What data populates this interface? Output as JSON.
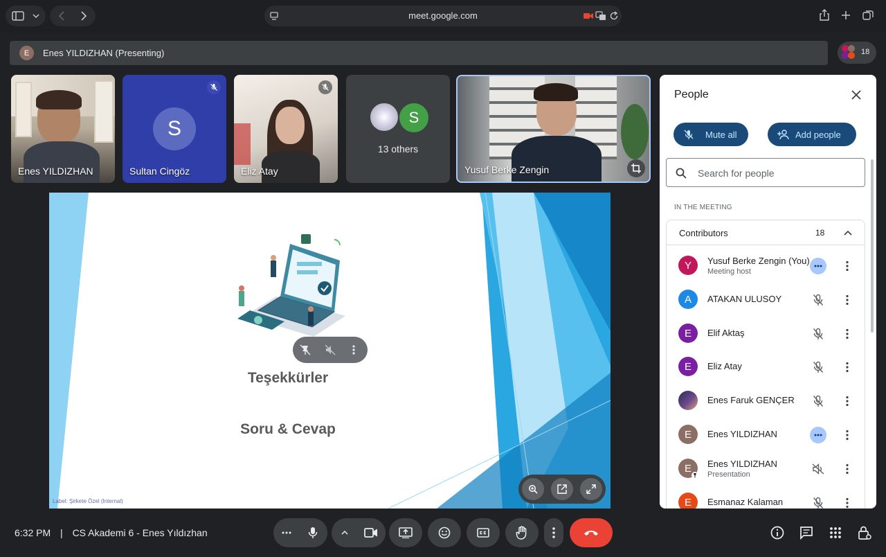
{
  "browser": {
    "url": "meet.google.com"
  },
  "presenting_bar": {
    "avatar_letter": "E",
    "label": "Enes YILDIZHAN (Presenting)",
    "participant_count": "18"
  },
  "tiles": [
    {
      "name": "Enes YILDIZHAN"
    },
    {
      "name": "Sultan Cingöz",
      "letter": "S"
    },
    {
      "name": "Eliz Atay"
    },
    {
      "others_label": "13 others",
      "letter": "S"
    },
    {
      "name": "Yusuf Berke Zengin"
    }
  ],
  "slide": {
    "title": "Teşekkürler",
    "subtitle": "Soru & Cevap",
    "footer_label": "Label: Şirkete Özel (Internal)"
  },
  "people_panel": {
    "title": "People",
    "mute_all": "Mute all",
    "add_people": "Add people",
    "search_placeholder": "Search for people",
    "section_label": "IN THE MEETING",
    "group_label": "Contributors",
    "group_count": "18",
    "participants": [
      {
        "letter": "Y",
        "name": "Yusuf Berke Zengin (You)",
        "sub": "Meeting host",
        "color": "#c2185b",
        "status": "more"
      },
      {
        "letter": "A",
        "name": "ATAKAN ULUSOY",
        "sub": "",
        "color": "#1e88e5",
        "status": "muted"
      },
      {
        "letter": "E",
        "name": "Elif Aktaş",
        "sub": "",
        "color": "#7b1fa2",
        "status": "muted"
      },
      {
        "letter": "E",
        "name": "Eliz Atay",
        "sub": "",
        "color": "#7b1fa2",
        "status": "muted"
      },
      {
        "letter": "",
        "name": "Enes Faruk GENÇER",
        "sub": "",
        "color": "#4a3b6b",
        "status": "muted"
      },
      {
        "letter": "E",
        "name": "Enes YILDIZHAN",
        "sub": "",
        "color": "#8d6e63",
        "status": "more"
      },
      {
        "letter": "E",
        "name": "Enes YILDIZHAN",
        "sub": "Presentation",
        "color": "#8d6e63",
        "status": "volume-off"
      },
      {
        "letter": "E",
        "name": "Esmanaz Kalaman",
        "sub": "",
        "color": "#e64a19",
        "status": "muted"
      }
    ]
  },
  "bottom_bar": {
    "time": "6:32 PM",
    "separator": "|",
    "meeting_title": "CS Akademi 6 - Enes Yıldızhan"
  },
  "colors": {
    "accent": "#a8c7fa",
    "end_call": "#ea4335",
    "background": "#202124"
  }
}
